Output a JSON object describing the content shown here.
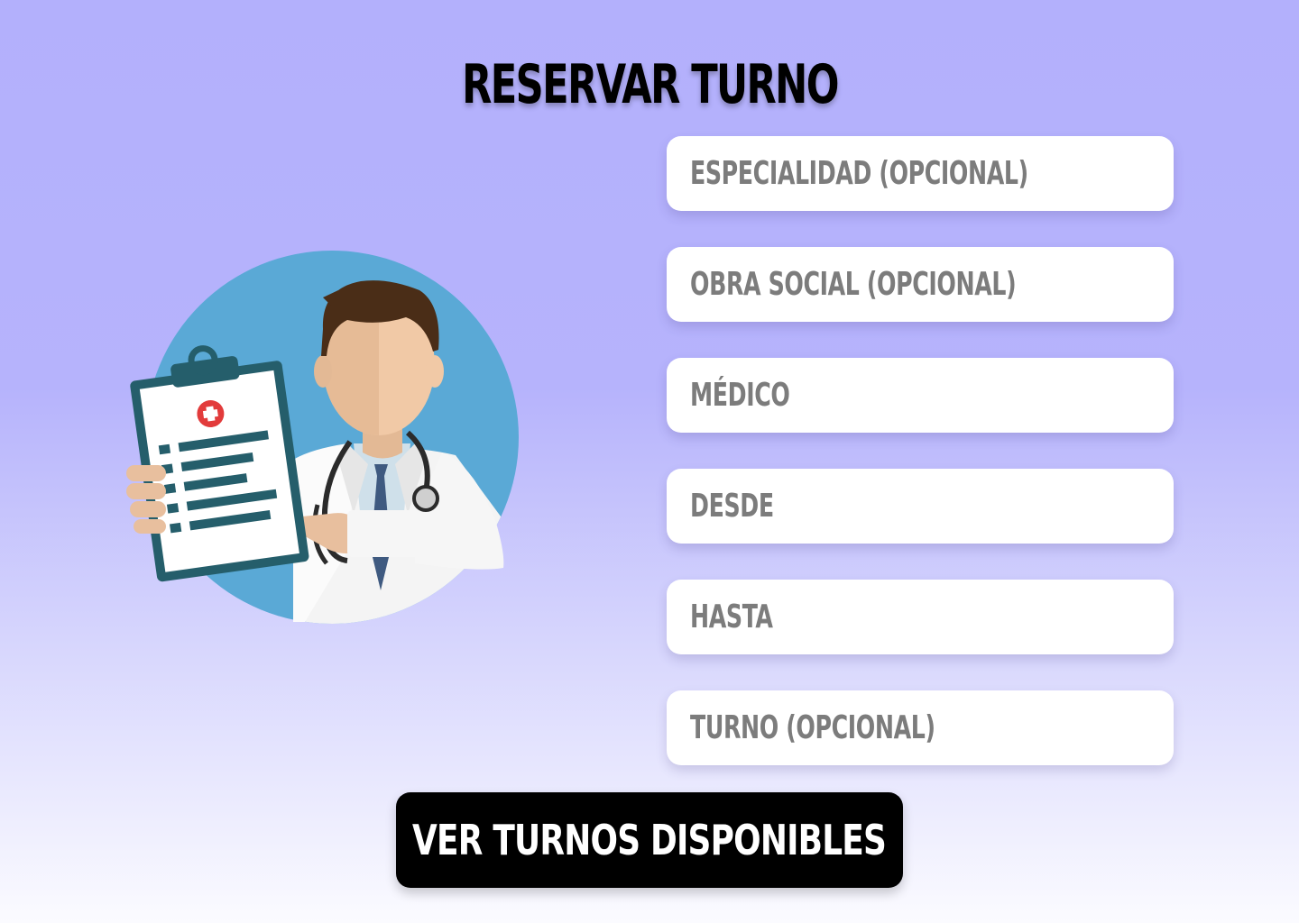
{
  "page": {
    "title": "RESERVAR TURNO"
  },
  "form": {
    "fields": [
      {
        "name": "especialidad",
        "label": "ESPECIALIDAD (OPCIONAL)"
      },
      {
        "name": "obra-social",
        "label": "OBRA SOCIAL (OPCIONAL)"
      },
      {
        "name": "medico",
        "label": "MÉDICO"
      },
      {
        "name": "desde",
        "label": "DESDE"
      },
      {
        "name": "hasta",
        "label": "HASTA"
      },
      {
        "name": "turno",
        "label": "TURNO (OPCIONAL)"
      }
    ],
    "submit_label": "VER TURNOS DISPONIBLES"
  },
  "illustration": {
    "icon": "doctor-with-clipboard-illustration"
  },
  "colors": {
    "background_top": "#b3b0fc",
    "background_bottom": "#fbfbff",
    "field_bg": "#ffffff",
    "field_text": "#7c7c7c",
    "button_bg": "#000000",
    "button_text": "#ffffff",
    "circle": "#5aa9d6"
  }
}
